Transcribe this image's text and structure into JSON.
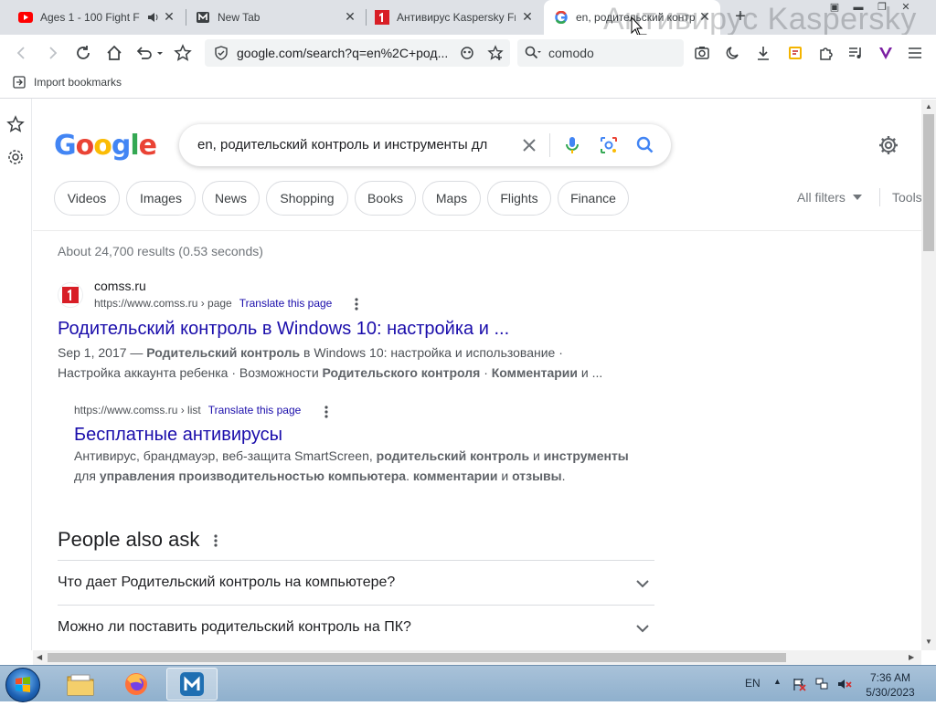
{
  "tabs": [
    {
      "title": "Ages 1 - 100 Fight F",
      "favicon": "youtube-icon"
    },
    {
      "title": "New Tab",
      "favicon": "vivaldi-icon"
    },
    {
      "title": "Антивирус Kaspersky Fr",
      "favicon": "comss-icon"
    },
    {
      "title": "en, родительский контр",
      "favicon": "google-icon"
    }
  ],
  "watermark": "Антивирус Kaspersky",
  "toolbar": {
    "url": "google.com/search?q=en%2C+род...",
    "search_query": "comodo"
  },
  "bookmarks": {
    "import_label": "Import bookmarks"
  },
  "google": {
    "logo": "Google",
    "query": "en, родительский контроль и инструменты дл",
    "chips": [
      "Videos",
      "Images",
      "News",
      "Shopping",
      "Books",
      "Maps",
      "Flights",
      "Finance"
    ],
    "all_filters": "All filters",
    "tools": "Tools",
    "stats": "About 24,700 results (0.53 seconds)"
  },
  "result1": {
    "site": "comss.ru",
    "cite": "https://www.comss.ru › page",
    "translate": "Translate this page",
    "title": "Родительский контроль в Windows 10: настройка и ...",
    "date": "Sep 1, 2017 —",
    "snip1_b1": "Родительский контроль",
    "snip1_t1": "в Windows 10: настройка и использование ·",
    "snip2_t1": "Настройка аккаунта ребенка · Возможности",
    "snip2_b1": "Родительского контроля",
    "snip2_t2": "·",
    "snip2_b2": "Комментарии",
    "snip2_t3": "и ..."
  },
  "result2": {
    "cite": "https://www.comss.ru › list",
    "translate": "Translate this page",
    "title": "Бесплатные антивирусы",
    "snip1_t1": "Антивирус, брандмауэр, веб-защита SmartScreen,",
    "snip1_b1": "родительский контроль",
    "snip1_t2": "и",
    "snip1_b2": "инструменты",
    "snip2_t1": "для",
    "snip2_b1": "управления производительностью компьютера",
    "snip2_t2": ".",
    "snip2_b2": "комментарии",
    "snip2_t3": "и",
    "snip2_b3": "отзывы",
    "snip2_t4": "."
  },
  "paa": {
    "title": "People also ask",
    "questions": [
      "Что дает Родительский контроль на компьютере?",
      "Можно ли поставить родительский контроль на ПК?"
    ]
  },
  "taskbar": {
    "lang": "EN",
    "time": "7:36 AM",
    "date": "5/30/2023"
  },
  "colors": {
    "link": "#1a0dab",
    "accent": "#4285f4"
  }
}
